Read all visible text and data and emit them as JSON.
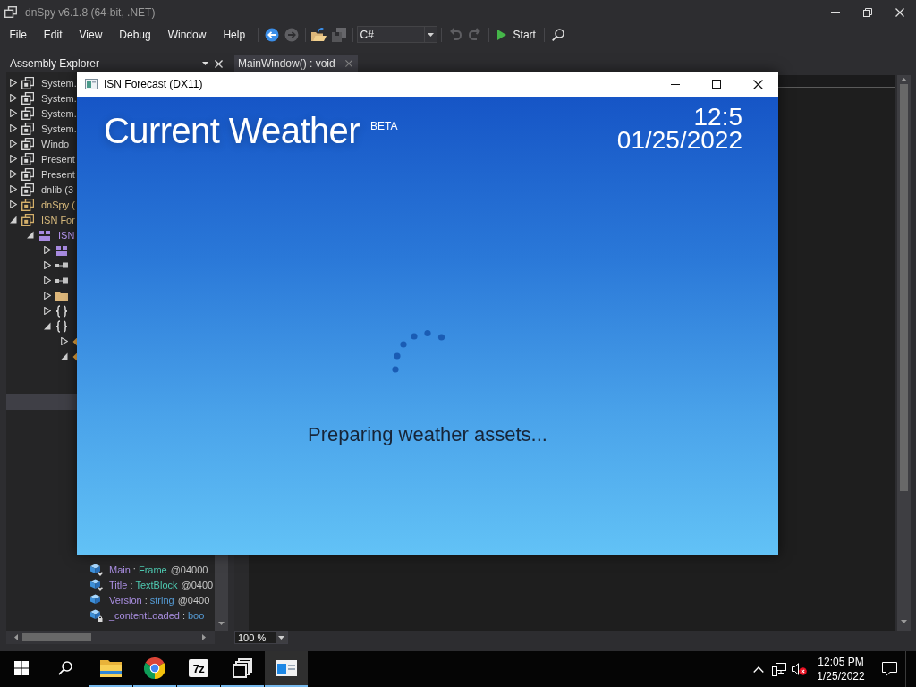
{
  "dnspy": {
    "title": "dnSpy v6.1.8 (64-bit, .NET)",
    "menu": [
      "File",
      "Edit",
      "View",
      "Debug",
      "Window",
      "Help"
    ],
    "toolbar": {
      "navigation": [
        {
          "kind": "back",
          "disabled": false
        },
        {
          "kind": "forward",
          "disabled": true
        }
      ],
      "files": [
        {
          "kind": "open",
          "disabled": false
        },
        {
          "kind": "save-all",
          "disabled": true
        }
      ],
      "language": "C#",
      "history": [
        {
          "kind": "undo",
          "disabled": true
        },
        {
          "kind": "redo",
          "disabled": true
        }
      ],
      "start": "Start"
    },
    "assembly_explorer": {
      "title": "Assembly Explorer",
      "tree": [
        {
          "label": "System.",
          "kind": "dll",
          "expanded": false
        },
        {
          "label": "System.",
          "kind": "dll",
          "expanded": false
        },
        {
          "label": "System.",
          "kind": "dll",
          "expanded": false
        },
        {
          "label": "System.",
          "kind": "dll",
          "expanded": false
        },
        {
          "label": "Windo",
          "kind": "dll",
          "expanded": false
        },
        {
          "label": "Present",
          "kind": "dll",
          "expanded": false
        },
        {
          "label": "Present",
          "kind": "dll",
          "expanded": false
        },
        {
          "label": "dnlib (3",
          "kind": "dll",
          "expanded": false
        },
        {
          "label": "dnSpy (",
          "kind": "exe",
          "expanded": false
        },
        {
          "label": "ISN For",
          "kind": "exe",
          "expanded": true,
          "children": [
            {
              "label": "ISN",
              "kind": "module",
              "expanded": true,
              "children": [
                {
                  "kind": "module",
                  "expanded": false
                },
                {
                  "kind": "reference",
                  "expanded": false
                },
                {
                  "kind": "reference",
                  "expanded": false
                },
                {
                  "kind": "folder",
                  "expanded": false
                },
                {
                  "kind": "namespace",
                  "expanded": false
                },
                {
                  "kind": "namespace",
                  "expanded": true,
                  "children": [
                    {
                      "kind": "class",
                      "expanded": false
                    },
                    {
                      "kind": "class",
                      "expanded": true
                    }
                  ]
                }
              ]
            }
          ]
        }
      ],
      "selected_row": {
        "selected": true
      },
      "members": [
        {
          "kind": "internal",
          "name": "Main",
          "separator": ":",
          "type": {
            "label": "Frame",
            "kind": "class"
          },
          "address": "@04000"
        },
        {
          "kind": "internal",
          "name": "Title",
          "separator": ":",
          "type": {
            "label": "TextBlock",
            "kind": "class"
          },
          "address": "@0400"
        },
        {
          "kind": "public",
          "name": "Version",
          "separator": ":",
          "type": {
            "label": "string",
            "kind": "keyword"
          },
          "address": "@0400"
        },
        {
          "kind": "private",
          "name": "_contentLoaded",
          "separator": ":",
          "type": {
            "label": "boo",
            "kind": "keyword"
          }
        }
      ]
    },
    "editor": {
      "tabs": [
        {
          "label": "MainWindow() : void",
          "selected": true
        }
      ],
      "zoom": "100 %"
    }
  },
  "forecast_window": {
    "title": "ISN Forecast (DX11)",
    "heading": "Current Weather",
    "badge": "BETA",
    "time": "12:5",
    "date": "01/25/2022",
    "status": "Preparing weather assets..."
  },
  "taskbar": {
    "apps": [
      {
        "kind": "explorer",
        "running": true,
        "selected": false
      },
      {
        "kind": "browser",
        "running": true,
        "selected": false
      },
      {
        "kind": "archiver",
        "logo": "7z",
        "running": true,
        "selected": false
      },
      {
        "kind": "decompiler",
        "running": true,
        "selected": false
      },
      {
        "kind": "forecast",
        "running": true,
        "selected": true
      }
    ],
    "volume_muted": true,
    "clock": {
      "time": "12:05 PM",
      "date": "1/25/2022"
    }
  }
}
